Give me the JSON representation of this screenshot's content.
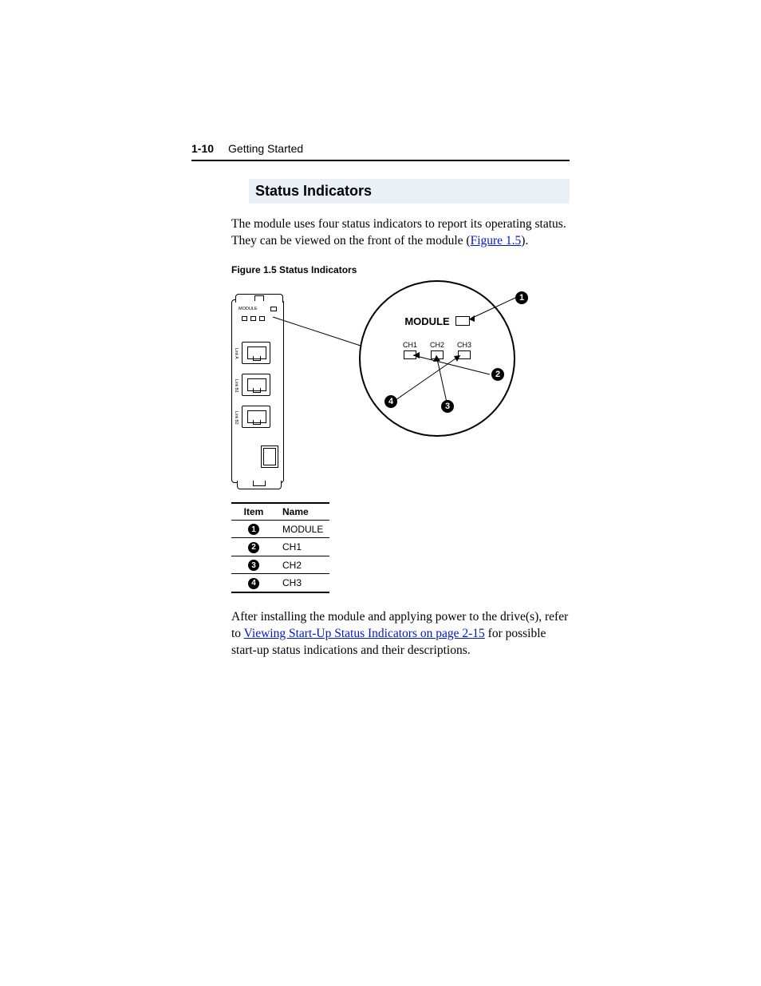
{
  "header": {
    "page_num": "1-10",
    "title": "Getting Started"
  },
  "section_title": "Status Indicators",
  "intro": {
    "pre": "The module uses four status indicators to report its operating status. They can be viewed on the front of the module (",
    "link": "Figure 1.5",
    "post": ")."
  },
  "figure": {
    "caption": "Figure 1.5   Status Indicators",
    "lens": {
      "module_label": "MODULE",
      "channels": [
        "CH1",
        "CH2",
        "CH3"
      ]
    },
    "device_side_labels": [
      "Link A",
      "Link B1",
      "Link B2"
    ]
  },
  "callouts": {
    "c1": "1",
    "c2": "2",
    "c3": "3",
    "c4": "4"
  },
  "legend": {
    "headers": {
      "item": "Item",
      "name": "Name"
    },
    "rows": [
      {
        "n": "1",
        "name": "MODULE"
      },
      {
        "n": "2",
        "name": "CH1"
      },
      {
        "n": "3",
        "name": "CH2"
      },
      {
        "n": "4",
        "name": "CH3"
      }
    ]
  },
  "outro": {
    "pre": "After installing the module and applying power to the drive(s), refer to ",
    "link": "Viewing Start-Up Status Indicators on page 2-15",
    "post": " for possible start-up status indications and their descriptions."
  }
}
